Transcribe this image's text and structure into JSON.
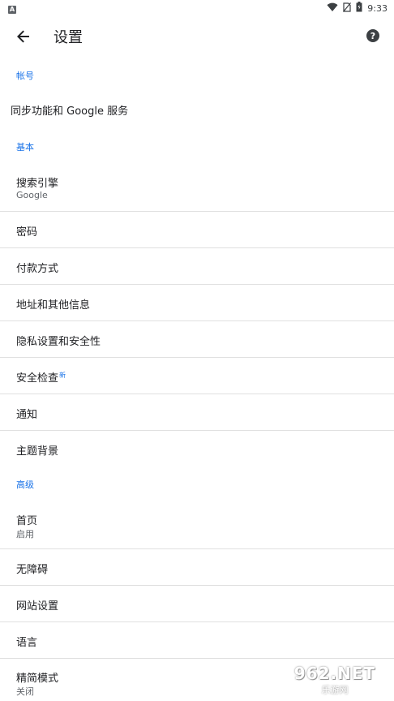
{
  "status_bar": {
    "app_badge": "A",
    "time": "9:33",
    "icons": [
      "wifi-icon",
      "no-sim-icon",
      "battery-icon"
    ]
  },
  "app_bar": {
    "title": "设置",
    "back_icon": "arrow-left-icon",
    "help_icon": "help-icon",
    "help_glyph": "?"
  },
  "sections": {
    "account": {
      "header": "帐号",
      "sync_label": "同步功能和 Google 服务"
    },
    "basic": {
      "header": "基本",
      "search_engine": {
        "label": "搜索引擎",
        "value": "Google"
      },
      "passwords": "密码",
      "payment": "付款方式",
      "addresses": "地址和其他信息",
      "privacy": "隐私设置和安全性",
      "safety_check": {
        "label": "安全检查",
        "badge": "新"
      },
      "notifications": "通知",
      "theme": "主题背景"
    },
    "advanced": {
      "header": "高级",
      "homepage": {
        "label": "首页",
        "value": "启用"
      },
      "accessibility": "无障碍",
      "site_settings": "网站设置",
      "languages": "语言",
      "lite_mode": {
        "label": "精简模式",
        "value": "关闭"
      }
    }
  },
  "watermark": {
    "main": "962.NET",
    "sub": "乐游网"
  },
  "colors": {
    "accent": "#1a73e8",
    "divider": "#e0e0e0",
    "text": "#202124",
    "subtext": "#5f6368"
  }
}
